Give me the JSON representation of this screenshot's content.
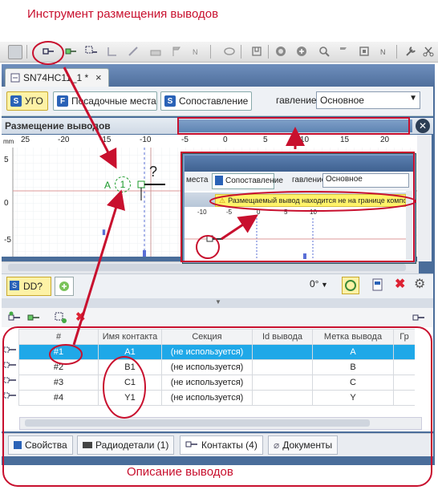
{
  "captions": {
    "top": "Инструмент размещения выводов",
    "bottom": "Описание выводов"
  },
  "doc_tab": {
    "label": "SN74HC11_1 *",
    "close": "×"
  },
  "view_tabs": {
    "ugo": "УГО",
    "ugo_icon": "S",
    "footprints": "Посадочные места",
    "footprints_icon": "F",
    "mapping": "Сопоставление",
    "mapping_icon": "S",
    "main_label": "гавление",
    "main_value": "Основное"
  },
  "panel": {
    "title": "Размещение выводов"
  },
  "ruler": {
    "unit": "mm",
    "ticks": [
      "25",
      "-20",
      "-15",
      "-10",
      "-5",
      "0",
      "5",
      "10",
      "15",
      "20"
    ],
    "vticks": [
      "5",
      "0",
      "-5"
    ]
  },
  "pin_on_canvas": {
    "name": "A",
    "number": "1",
    "marker": "?"
  },
  "inset": {
    "footprints": "места",
    "mapping": "Сопоставление",
    "main_label": "гавление",
    "main_value": "Основное",
    "warning": "Размещаемый вывод находится не на границе компонента",
    "ticks": [
      "-10",
      "-5",
      "0",
      "5",
      "10"
    ]
  },
  "bottom_toolbar": {
    "designator": "DD?",
    "angle": "0°"
  },
  "table": {
    "headers": [
      "#",
      "Имя контакта",
      "Секция",
      "Id вывода",
      "Метка вывода",
      "Гр"
    ],
    "rows": [
      {
        "num": "#1",
        "name": "A1",
        "section": "(не используется)",
        "id": "",
        "label": "A"
      },
      {
        "num": "#2",
        "name": "B1",
        "section": "(не используется)",
        "id": "",
        "label": "B"
      },
      {
        "num": "#3",
        "name": "C1",
        "section": "(не используется)",
        "id": "",
        "label": "C"
      },
      {
        "num": "#4",
        "name": "Y1",
        "section": "(не используется)",
        "id": "",
        "label": "Y"
      }
    ]
  },
  "bottom_tabs": {
    "props": "Свойства",
    "parts": "Радиодетали (1)",
    "contacts": "Контакты (4)",
    "docs": "Документы"
  },
  "colors": {
    "accent": "#c8102e",
    "selection": "#1fa8e8",
    "frame": "#4a6d9a",
    "warning_bar": "#fff36a"
  }
}
